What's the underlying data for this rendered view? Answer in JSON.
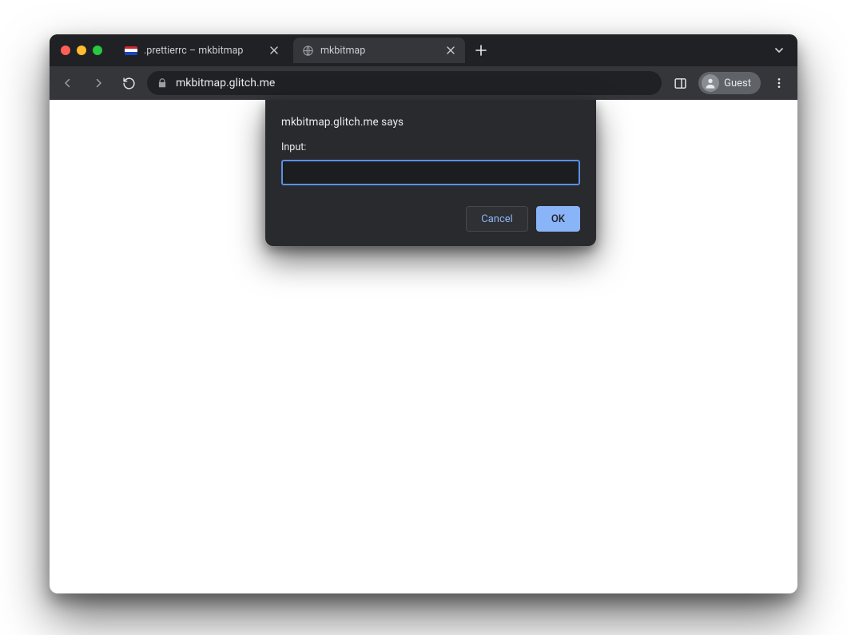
{
  "tabs": [
    {
      "title": ".prettierrc – mkbitmap",
      "active": false,
      "favicon": "flag"
    },
    {
      "title": "mkbitmap",
      "active": true,
      "favicon": "globe"
    }
  ],
  "toolbar": {
    "url": "mkbitmap.glitch.me",
    "guest_label": "Guest"
  },
  "dialog": {
    "origin_text": "mkbitmap.glitch.me says",
    "prompt_label": "Input:",
    "input_value": "",
    "cancel_label": "Cancel",
    "ok_label": "OK"
  },
  "colors": {
    "accent_blue": "#8ab4f8",
    "focus_border": "#5b8fe6",
    "dialog_bg": "#292a2d",
    "chrome_bg": "#35363a"
  }
}
